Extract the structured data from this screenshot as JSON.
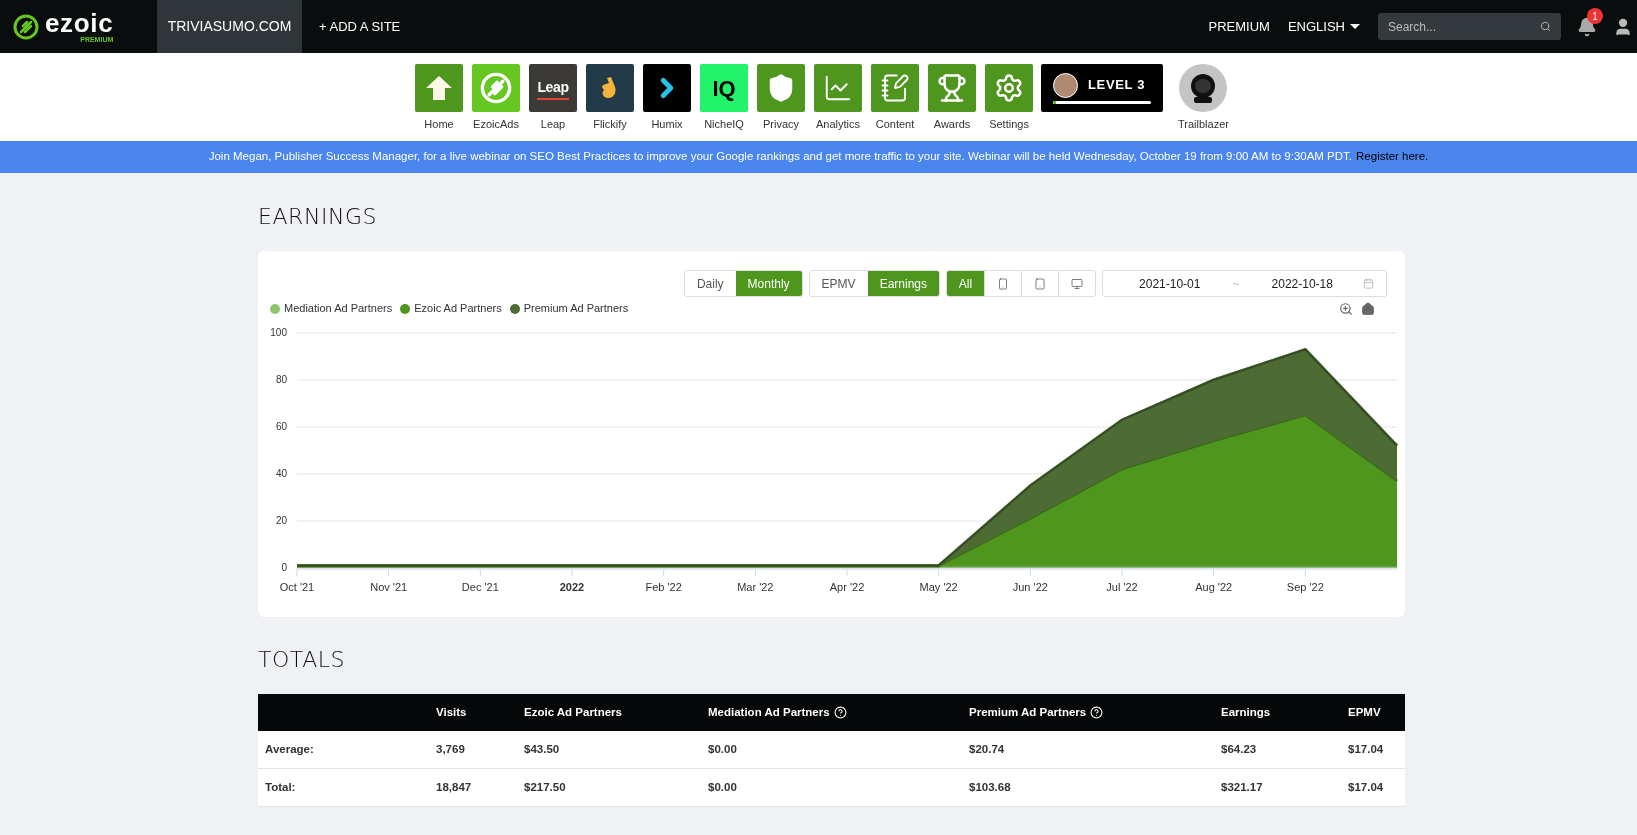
{
  "topbar": {
    "logo": "ezoic",
    "logo_badge": "PREMIUM",
    "site_tab": {
      "label": "TRIVIASUMO.COM",
      "selected": true
    },
    "add_site": "+ ADD A SITE",
    "premium": "PREMIUM",
    "language": "ENGLISH",
    "search": {
      "placeholder": "Search..."
    },
    "notifications": "1"
  },
  "apps": [
    {
      "kind": "home",
      "label": "Home"
    },
    {
      "kind": "ezoicads",
      "label": "EzoicAds"
    },
    {
      "kind": "leap",
      "label": "Leap",
      "icon_text": "Leap"
    },
    {
      "kind": "flickify",
      "label": "Flickify"
    },
    {
      "kind": "humix",
      "label": "Humix"
    },
    {
      "kind": "nicheiq",
      "label": "NicheIQ",
      "icon_text": "IQ"
    },
    {
      "kind": "privacy",
      "label": "Privacy"
    },
    {
      "kind": "analytics",
      "label": "Analytics"
    },
    {
      "kind": "content",
      "label": "Content"
    },
    {
      "kind": "awards",
      "label": "Awards"
    },
    {
      "kind": "settings",
      "label": "Settings"
    }
  ],
  "level_badge": {
    "label": "LEVEL 3",
    "level": 0.03
  },
  "trailblazer": {
    "label": "Trailblazer"
  },
  "banner": {
    "text": "Join Megan, Publisher Success Manager, for a live webinar on SEO Best Practices to improve your Google rankings and get more traffic to your site. Webinar will be held Wednesday, October 19 from 9:00 AM to 9:30AM PDT.",
    "link": "Register here."
  },
  "earnings": {
    "title": "EARNINGS",
    "toggle_groups": [
      [
        {
          "label": "Daily",
          "selected": false
        },
        {
          "label": "Monthly",
          "selected": true
        }
      ],
      [
        {
          "label": "EPMV",
          "selected": false
        },
        {
          "label": "Earnings",
          "selected": true
        }
      ]
    ],
    "devices": [
      {
        "kind": "all",
        "label": "All",
        "selected": true
      },
      {
        "kind": "phone",
        "selected": false
      },
      {
        "kind": "tablet",
        "selected": false
      },
      {
        "kind": "desktop",
        "selected": false
      }
    ],
    "date_range": {
      "start": "2021-10-01",
      "separator": "~",
      "end": "2022-10-18"
    },
    "chart_data": {
      "type": "area",
      "stacked": true,
      "categories": [
        "Oct '21",
        "Nov '21",
        "Dec '21",
        "2022",
        "Feb '22",
        "Mar '22",
        "Apr '22",
        "May '22",
        "Jun '22",
        "Jul '22",
        "Aug '22",
        "Sep '22",
        null
      ],
      "ylim": [
        0,
        100
      ],
      "grid": true,
      "yticks": [
        0,
        20,
        40,
        60,
        80,
        100
      ],
      "series": [
        {
          "name": "Mediation Ad Partners",
          "color": "#8cc56a",
          "values": [
            1,
            1,
            1,
            1,
            1,
            1,
            1,
            1,
            1,
            1,
            1,
            1,
            1
          ]
        },
        {
          "name": "Ezoic Ad Partners",
          "color": "#4f961e",
          "values": [
            0,
            0,
            0,
            0,
            0,
            0,
            0,
            0,
            20,
            41,
            53,
            64,
            36
          ]
        },
        {
          "name": "Premium Ad Partners",
          "color": "#4c6c34",
          "values": [
            0,
            0,
            0,
            0,
            0,
            0,
            0,
            0,
            14,
            21,
            26,
            28,
            15
          ]
        }
      ]
    }
  },
  "totals": {
    "title": "TOTALS",
    "columns": [
      {
        "label": "Visits",
        "help": false
      },
      {
        "label": "Ezoic Ad Partners",
        "help": false
      },
      {
        "label": "Mediation Ad Partners",
        "help": true
      },
      {
        "label": "Premium Ad Partners",
        "help": true
      },
      {
        "label": "Earnings",
        "help": false
      },
      {
        "label": "EPMV",
        "help": false
      }
    ],
    "rows": [
      {
        "label": "Average:",
        "cells": [
          "3,769",
          "$43.50",
          "$0.00",
          "$20.74",
          "$64.23",
          "$17.04"
        ]
      },
      {
        "label": "Total:",
        "cells": [
          "18,847",
          "$217.50",
          "$0.00",
          "$103.68",
          "$321.17",
          "$17.04"
        ]
      }
    ]
  }
}
